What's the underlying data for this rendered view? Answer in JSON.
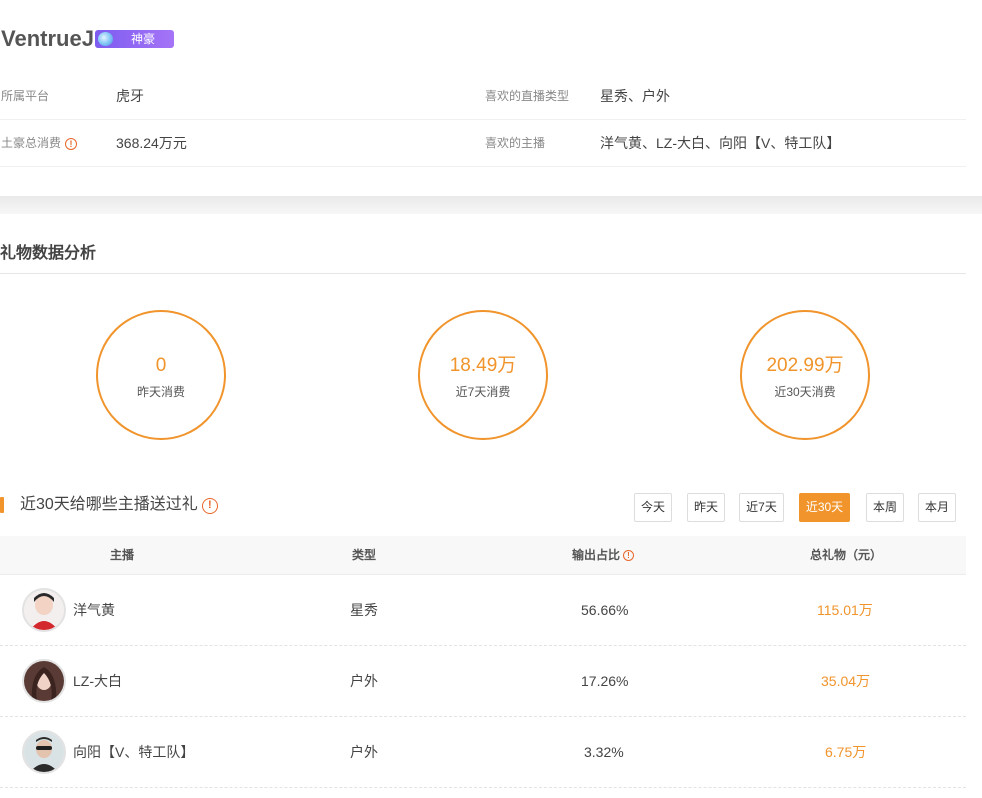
{
  "profile": {
    "name": "VentrueJ",
    "rank_badge": "神豪",
    "platform_label": "所属平台",
    "platform_value": "虎牙",
    "fav_type_label": "喜欢的直播类型",
    "fav_type_value": "星秀、户外",
    "spend_label": "土豪总消费",
    "spend_value": "368.24万元",
    "fav_anchor_label": "喜欢的主播",
    "fav_anchor_value": "洋气黄、LZ-大白、向阳【V、特工队】"
  },
  "analysis": {
    "title": "礼物数据分析",
    "stats": [
      {
        "value": "0",
        "label": "昨天消费"
      },
      {
        "value": "18.49万",
        "label": "近7天消费"
      },
      {
        "value": "202.99万",
        "label": "近30天消费"
      }
    ]
  },
  "gift_list": {
    "title": "近30天给哪些主播送过礼",
    "filters": [
      "今天",
      "昨天",
      "近7天",
      "近30天",
      "本周",
      "本月"
    ],
    "active_filter": "近30天",
    "columns": {
      "anchor": "主播",
      "type": "类型",
      "share": "输出占比",
      "total": "总礼物（元）"
    },
    "rows": [
      {
        "name": "洋气黄",
        "type": "星秀",
        "share": "56.66%",
        "total": "115.01万"
      },
      {
        "name": "LZ-大白",
        "type": "户外",
        "share": "17.26%",
        "total": "35.04万"
      },
      {
        "name": "向阳【V、特工队】",
        "type": "户外",
        "share": "3.32%",
        "total": "6.75万"
      }
    ]
  },
  "icons": {
    "warning": "exclamation-circle-icon",
    "badge_gem": "gem-icon",
    "avatar": "avatar-image"
  },
  "colors": {
    "accent": "#f0942b",
    "badge": "#8b63f3",
    "warning": "#e8672a"
  }
}
